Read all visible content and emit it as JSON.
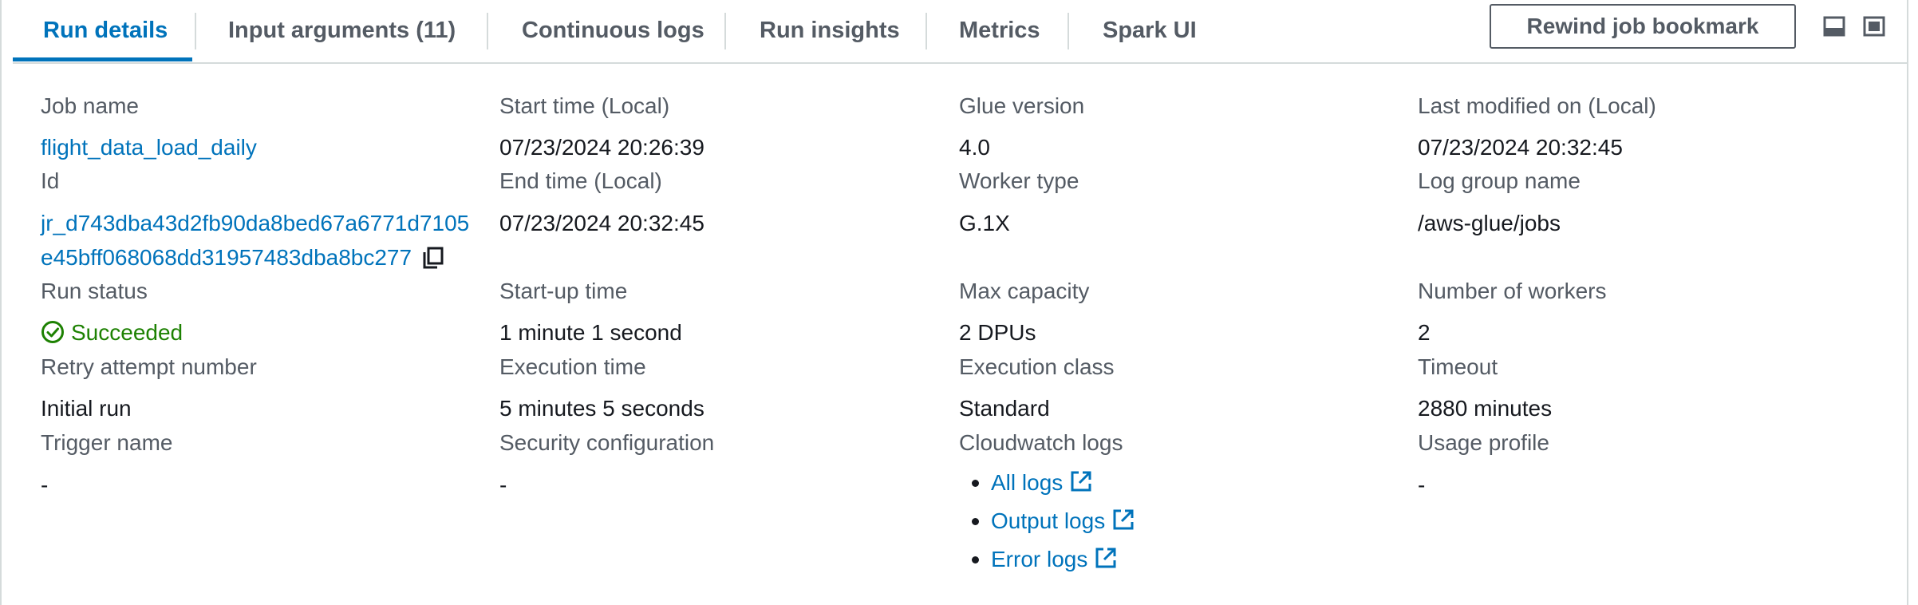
{
  "tabs": [
    {
      "label": "Run details",
      "active": true
    },
    {
      "label": "Input arguments (11)",
      "active": false
    },
    {
      "label": "Continuous logs",
      "active": false
    },
    {
      "label": "Run insights",
      "active": false
    },
    {
      "label": "Metrics",
      "active": false
    },
    {
      "label": "Spark UI",
      "active": false
    }
  ],
  "toolbar": {
    "rewind_label": "Rewind job bookmark",
    "icons": [
      "collapse-panel-icon",
      "expand-panel-icon"
    ]
  },
  "details": {
    "col1": {
      "job_name_label": "Job name",
      "job_name_value": "flight_data_load_daily",
      "id_label": "Id",
      "id_value_line1": "jr_d743dba43d2fb90da8bed67a6771d7105",
      "id_value_line2": "e45bff068068dd31957483dba8bc277",
      "run_status_label": "Run status",
      "run_status_value": "Succeeded",
      "retry_label": "Retry attempt number",
      "retry_value": "Initial run",
      "trigger_label": "Trigger name",
      "trigger_value": "-"
    },
    "col2": {
      "start_time_label": "Start time (Local)",
      "start_time_value": "07/23/2024 20:26:39",
      "end_time_label": "End time (Local)",
      "end_time_value": "07/23/2024 20:32:45",
      "startup_label": "Start-up time",
      "startup_value": "1 minute 1 second",
      "exec_time_label": "Execution time",
      "exec_time_value": "5 minutes 5 seconds",
      "security_label": "Security configuration",
      "security_value": "-"
    },
    "col3": {
      "glue_version_label": "Glue version",
      "glue_version_value": "4.0",
      "worker_type_label": "Worker type",
      "worker_type_value": "G.1X",
      "max_capacity_label": "Max capacity",
      "max_capacity_value": "2 DPUs",
      "exec_class_label": "Execution class",
      "exec_class_value": "Standard",
      "cloudwatch_label": "Cloudwatch logs",
      "cloudwatch_links": [
        "All logs",
        "Output logs",
        "Error logs"
      ]
    },
    "col4": {
      "last_modified_label": "Last modified on (Local)",
      "last_modified_value": "07/23/2024 20:32:45",
      "log_group_label": "Log group name",
      "log_group_value": "/aws-glue/jobs",
      "num_workers_label": "Number of workers",
      "num_workers_value": "2",
      "timeout_label": "Timeout",
      "timeout_value": "2880 minutes",
      "usage_profile_label": "Usage profile",
      "usage_profile_value": "-"
    }
  },
  "colors": {
    "accent": "#0073bb",
    "success": "#1d8102",
    "label": "#545b64",
    "text": "#16191f",
    "border": "#d5dbdb"
  }
}
